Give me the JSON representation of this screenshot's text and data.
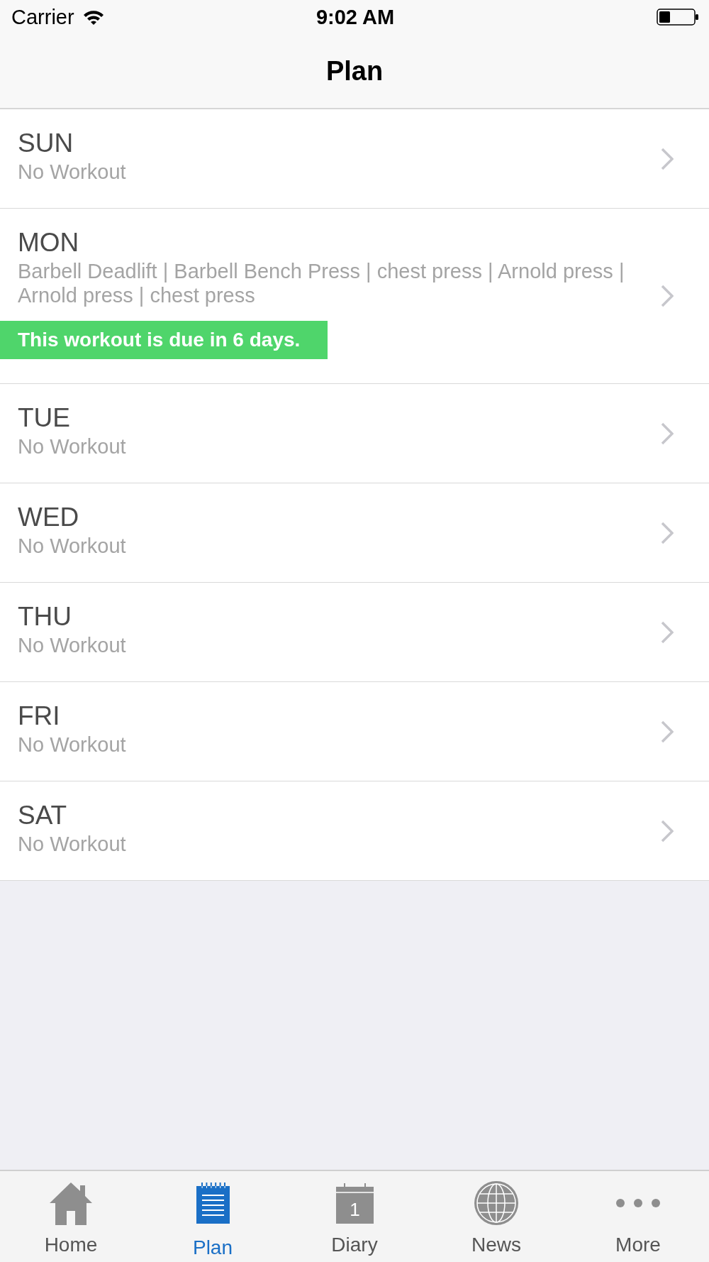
{
  "status_bar": {
    "carrier": "Carrier",
    "time": "9:02 AM"
  },
  "nav_bar": {
    "title": "Plan"
  },
  "days": [
    {
      "day": "SUN",
      "summary": "No Workout"
    },
    {
      "day": "MON",
      "summary": "Barbell Deadlift | Barbell Bench Press | chest press | Arnold press | Arnold press | chest press",
      "due_notice": "This workout is due in 6 days."
    },
    {
      "day": "TUE",
      "summary": "No Workout"
    },
    {
      "day": "WED",
      "summary": "No Workout"
    },
    {
      "day": "THU",
      "summary": "No Workout"
    },
    {
      "day": "FRI",
      "summary": "No Workout"
    },
    {
      "day": "SAT",
      "summary": "No Workout"
    }
  ],
  "tab_bar": {
    "tabs": [
      {
        "label": "Home",
        "selected": false
      },
      {
        "label": "Plan",
        "selected": true
      },
      {
        "label": "Diary",
        "selected": false,
        "icon_text": "1"
      },
      {
        "label": "News",
        "selected": false
      },
      {
        "label": "More",
        "selected": false
      }
    ]
  }
}
